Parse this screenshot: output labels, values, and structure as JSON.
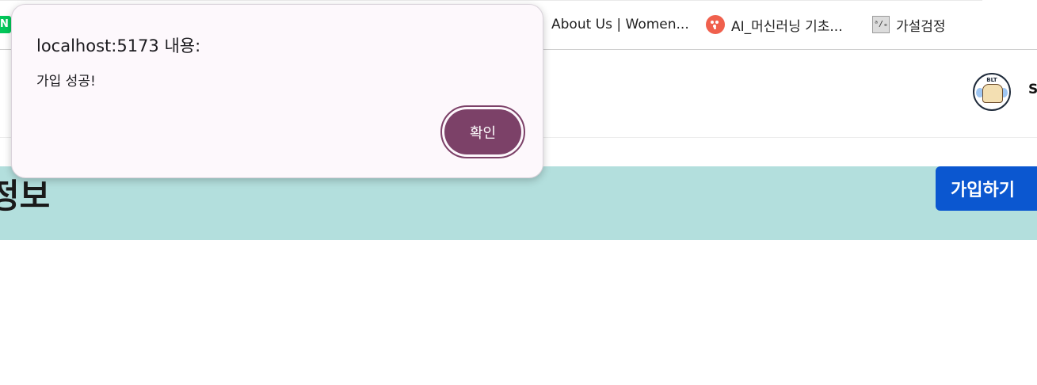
{
  "bookmarks": {
    "naver_label": "N",
    "items": [
      {
        "label": "About Us | Women..."
      },
      {
        "label": "AI_머신러닝 기초..."
      },
      {
        "label": "가설검정"
      }
    ],
    "doc_icon_glyph": "ᵃ/ₑ"
  },
  "header": {
    "logo_text": "BLT",
    "clipped_text": "S"
  },
  "banner": {
    "title_fragment": "정보",
    "signup_label": "가입하기",
    "background_color": "#b3dfdd",
    "button_color": "#0b57d0"
  },
  "alert": {
    "title": "localhost:5173 내용:",
    "message": "가입 성공!",
    "confirm_label": "확인",
    "accent_color": "#7c4168"
  }
}
